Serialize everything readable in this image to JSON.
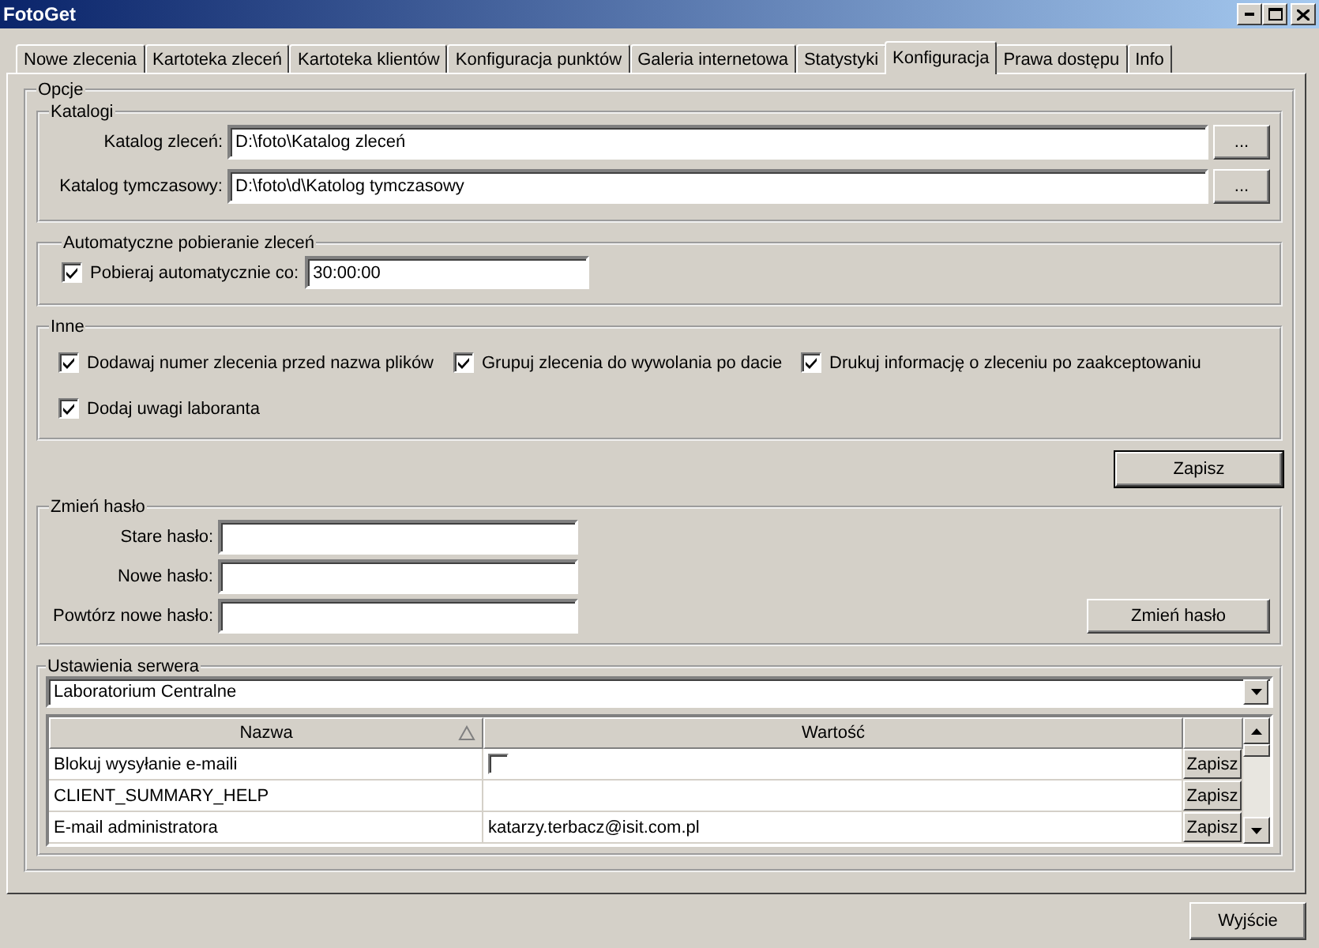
{
  "window": {
    "title": "FotoGet"
  },
  "tabs": [
    {
      "label": "Nowe zlecenia",
      "selected": false
    },
    {
      "label": "Kartoteka zleceń",
      "selected": false
    },
    {
      "label": "Kartoteka klientów",
      "selected": false
    },
    {
      "label": "Konfiguracja punktów",
      "selected": false
    },
    {
      "label": "Galeria internetowa",
      "selected": false
    },
    {
      "label": "Statystyki",
      "selected": false
    },
    {
      "label": "Konfiguracja",
      "selected": true
    },
    {
      "label": "Prawa dostępu",
      "selected": false
    },
    {
      "label": "Info",
      "selected": false
    }
  ],
  "options": {
    "title": "Opcje",
    "catalogs": {
      "title": "Katalogi",
      "fields": [
        {
          "label": "Katalog zleceń:",
          "value": "D:\\foto\\Katalog zleceń",
          "button": "..."
        },
        {
          "label": "Katalog tymczasowy:",
          "value": "D:\\foto\\d\\Katolog tymczasowy",
          "button": "..."
        }
      ]
    },
    "auto": {
      "title": "Automatyczne pobieranie zleceń",
      "label": "Pobieraj automatycznie co:",
      "checked": true,
      "value": "30:00:00"
    },
    "other": {
      "title": "Inne",
      "checkboxes": [
        {
          "label": "Dodawaj numer zlecenia przed nazwa plików",
          "checked": true
        },
        {
          "label": "Grupuj zlecenia do wywolania po dacie",
          "checked": true
        },
        {
          "label": "Drukuj informację o zleceniu po zaakceptowaniu",
          "checked": true
        },
        {
          "label": "Dodaj uwagi laboranta",
          "checked": true
        }
      ]
    },
    "save_button": "Zapisz",
    "password": {
      "title": "Zmień hasło",
      "fields": [
        {
          "label": "Stare hasło:"
        },
        {
          "label": "Nowe hasło:"
        },
        {
          "label": "Powtórz nowe hasło:"
        }
      ],
      "button": "Zmień hasło"
    },
    "server": {
      "title": "Ustawienia serwera",
      "dropdown": "Laboratorium Centralne",
      "columns": [
        "Nazwa",
        "Wartość"
      ],
      "rows": [
        {
          "name": "Blokuj wysyłanie e-maili",
          "kind": "checkbox",
          "checked": false,
          "button": "Zapisz"
        },
        {
          "name": "CLIENT_SUMMARY_HELP",
          "kind": "text",
          "button": "Zapisz"
        },
        {
          "name": "E-mail administratora",
          "kind": "text",
          "value": "katarzy.terbacz@isit.com.pl",
          "button": "Zapisz"
        }
      ]
    }
  },
  "exit_button": "Wyjście"
}
